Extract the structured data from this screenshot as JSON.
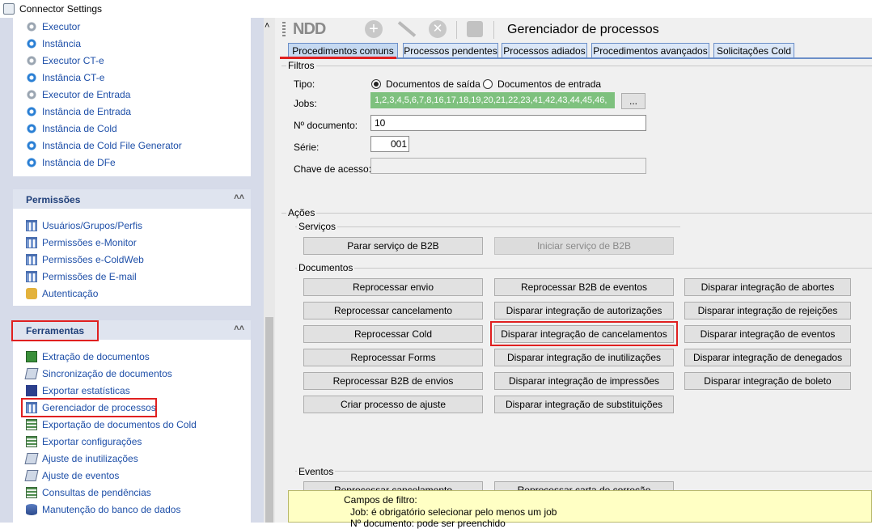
{
  "window": {
    "title": "Connector Settings"
  },
  "sidebar": {
    "top_items": [
      {
        "label": "Executor",
        "icon": "gear-gray-icon"
      },
      {
        "label": "Instância",
        "icon": "gear-blue-icon"
      },
      {
        "label": "Executor CT-e",
        "icon": "gear-gray-icon"
      },
      {
        "label": "Instância CT-e",
        "icon": "gear-blue-icon"
      },
      {
        "label": "Executor de Entrada",
        "icon": "gear-gray-icon"
      },
      {
        "label": "Instância de Entrada",
        "icon": "gear-blue-icon"
      },
      {
        "label": "Instância de Cold",
        "icon": "gear-blue-icon"
      },
      {
        "label": "Instância de Cold File Generator",
        "icon": "gear-blue-icon"
      },
      {
        "label": "Instância de DFe",
        "icon": "gear-blue-icon"
      }
    ],
    "permissoes": {
      "title": "Permissões",
      "items": [
        {
          "label": "Usuários/Grupos/Perfis",
          "icon": "users-grid-icon"
        },
        {
          "label": "Permissões e-Monitor",
          "icon": "users-grid-icon"
        },
        {
          "label": "Permissões e-ColdWeb",
          "icon": "users-grid-icon"
        },
        {
          "label": "Permissões de E-mail",
          "icon": "users-grid-icon"
        },
        {
          "label": "Autenticação",
          "icon": "key-icon"
        }
      ]
    },
    "ferramentas": {
      "title": "Ferramentas",
      "items": [
        {
          "label": "Extração de documentos",
          "icon": "extract-icon"
        },
        {
          "label": "Sincronização de documentos",
          "icon": "page-icon"
        },
        {
          "label": "Exportar estatísticas",
          "icon": "chart-icon"
        },
        {
          "label": "Gerenciador de processos",
          "icon": "process-grid-icon"
        },
        {
          "label": "Exportação de documentos do Cold",
          "icon": "export-icon"
        },
        {
          "label": "Exportar configurações",
          "icon": "export-icon"
        },
        {
          "label": "Ajuste de inutilizações",
          "icon": "page-icon"
        },
        {
          "label": "Ajuste de eventos",
          "icon": "page-icon"
        },
        {
          "label": "Consultas de pendências",
          "icon": "table-icon"
        },
        {
          "label": "Manutenção do banco de dados",
          "icon": "database-icon"
        }
      ]
    }
  },
  "toolbar": {
    "logo": "NDD",
    "title": "Gerenciador de processos"
  },
  "tabs": [
    {
      "label": "Procedimentos comuns",
      "active": true
    },
    {
      "label": "Processos pendentes",
      "active": false
    },
    {
      "label": "Processos adiados",
      "active": false
    },
    {
      "label": "Procedimentos avançados",
      "active": false
    },
    {
      "label": "Solicitações Cold",
      "active": false
    }
  ],
  "filtros": {
    "title": "Filtros",
    "tipo_label": "Tipo:",
    "tipo_options": [
      {
        "label": "Documentos de saída",
        "selected": true
      },
      {
        "label": "Documentos de entrada",
        "selected": false
      }
    ],
    "jobs_label": "Jobs:",
    "jobs_value": "1,2,3,4,5,6,7,8,16,17,18,19,20,21,22,23,41,42,43,44,45,46,",
    "jobs_button": "...",
    "documento_label": "Nº documento:",
    "documento_value": "10",
    "serie_label": "Série:",
    "serie_value": "001",
    "chave_label": "Chave de acesso:",
    "chave_value": ""
  },
  "acoes": {
    "title": "Ações",
    "servicos": {
      "title": "Serviços",
      "buttons": [
        {
          "label": "Parar serviço de B2B",
          "enabled": true
        },
        {
          "label": "Iniciar serviço de B2B",
          "enabled": false
        }
      ]
    },
    "documentos": {
      "title": "Documentos",
      "col1": [
        "Reprocessar envio",
        "Reprocessar cancelamento",
        "Reprocessar Cold",
        "Reprocessar Forms",
        "Reprocessar B2B de envios",
        "Criar processo de ajuste"
      ],
      "col2": [
        "Reprocessar B2B de eventos",
        "Disparar integração de autorizações",
        "Disparar integração de cancelamentos",
        "Disparar integração de inutilizações",
        "Disparar integração de impressões",
        "Disparar integração de substituições"
      ],
      "col3": [
        "Disparar integração de abortes",
        "Disparar integração de rejeições",
        "Disparar integração de eventos",
        "Disparar integração de denegados",
        "Disparar integração de boleto"
      ]
    },
    "eventos": {
      "title": "Eventos",
      "buttons": [
        "Reprocessar cancelamento",
        "Reprocessar carta de correção"
      ]
    }
  },
  "help": {
    "line1": "Campos de filtro:",
    "line2": "Job: é obrigatório selecionar pelo menos um job",
    "line3": "Nº documento: pode ser preenchido"
  },
  "colors": {
    "accent": "#1e4fa8",
    "highlight": "#e02020",
    "jobs_bg": "#7ec17e"
  }
}
